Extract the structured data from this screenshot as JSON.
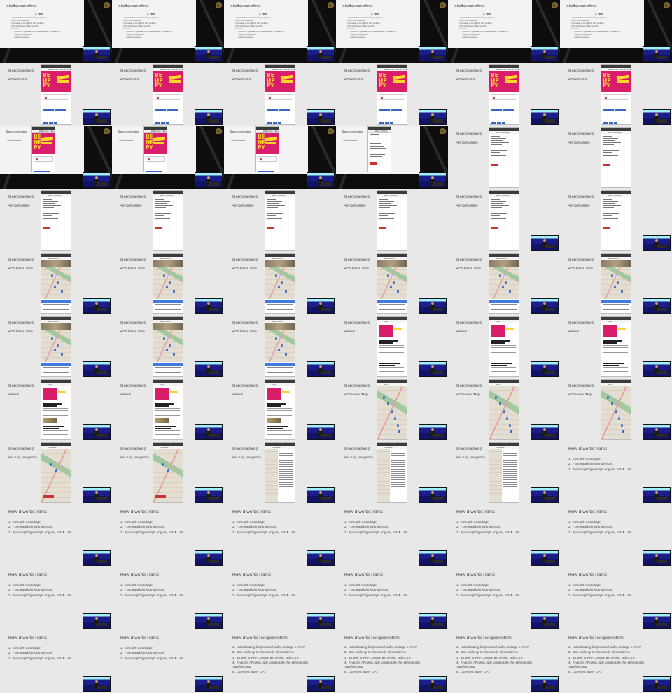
{
  "tiles": [
    {
      "type": "toc",
      "dark": true,
      "title": "Inhaltsverzeichnis"
    },
    {
      "type": "toc",
      "dark": true,
      "title": "Inhaltsverzeichnis"
    },
    {
      "type": "toc",
      "dark": true,
      "title": "Inhaltsverzeichnis"
    },
    {
      "type": "toc",
      "dark": true,
      "title": "Inhaltsverzeichnis"
    },
    {
      "type": "toc",
      "dark": true,
      "title": "Inhaltsverzeichnis"
    },
    {
      "type": "toc",
      "dark": true,
      "title": "Inhaltsverzeichnis"
    },
    {
      "type": "screen",
      "title": "Screenshots",
      "bullet": "• Dashboard",
      "phone": "dash"
    },
    {
      "type": "screen",
      "title": "Screenshots",
      "bullet": "• Dashboard",
      "phone": "dash"
    },
    {
      "type": "screen",
      "title": "Screenshots",
      "bullet": "• Dashboard",
      "phone": "dash"
    },
    {
      "type": "screen",
      "title": "Screenshots",
      "bullet": "• Dashboard",
      "phone": "dash"
    },
    {
      "type": "screen",
      "title": "Screenshots",
      "bullet": "• Dashboard",
      "phone": "dash"
    },
    {
      "type": "screen",
      "title": "Screenshots",
      "bullet": "• Dashboard",
      "phone": "dash"
    },
    {
      "type": "screen",
      "dark": true,
      "title": "Screenshots",
      "bullet": "• Dashboard",
      "phone": "dash"
    },
    {
      "type": "screen",
      "dark": true,
      "title": "Screenshots",
      "bullet": "• Dashboard",
      "phone": "dash"
    },
    {
      "type": "screen",
      "dark": true,
      "title": "Screenshots",
      "bullet": "• Dashboard",
      "phone": "dash"
    },
    {
      "type": "screen",
      "dark": true,
      "title": "Screenshots",
      "bullet": "• Dashboard",
      "phone": "engel"
    },
    {
      "type": "screen",
      "title": "Screenshots",
      "bullet": "• Engelsystem",
      "phone": "engel",
      "cam": false
    },
    {
      "type": "screen",
      "title": "Screenshots",
      "bullet": "• Engelsystem",
      "phone": "engel",
      "cam": false
    },
    {
      "type": "screen",
      "title": "Screenshots",
      "bullet": "• Engelsystem",
      "phone": "engel",
      "cam": false
    },
    {
      "type": "screen",
      "title": "Screenshots",
      "bullet": "• Engelsystem",
      "phone": "engel",
      "cam": false
    },
    {
      "type": "screen",
      "title": "Screenshots",
      "bullet": "• Engelsystem",
      "phone": "engel",
      "cam": false
    },
    {
      "type": "screen",
      "title": "Screenshots",
      "bullet": "• Engelsystem",
      "phone": "engel",
      "cam": false
    },
    {
      "type": "screen",
      "title": "Screenshots",
      "bullet": "• Engelsystem",
      "phone": "engel"
    },
    {
      "type": "screen",
      "title": "Screenshots",
      "bullet": "• Engelsystem",
      "phone": "engel"
    },
    {
      "type": "screen",
      "title": "Screenshots",
      "bullet": "• Ort Detail View",
      "phone": "mapdetail"
    },
    {
      "type": "screen",
      "title": "Screenshots",
      "bullet": "• Ort Detail View",
      "phone": "mapdetail"
    },
    {
      "type": "screen",
      "title": "Screenshots",
      "bullet": "• Ort Detail View",
      "phone": "mapdetail"
    },
    {
      "type": "screen",
      "title": "Screenshots",
      "bullet": "• Ort Detail View",
      "phone": "mapdetail"
    },
    {
      "type": "screen",
      "title": "Screenshots",
      "bullet": "• Ort Detail View",
      "phone": "mapdetail"
    },
    {
      "type": "screen",
      "title": "Screenshots",
      "bullet": "• Ort Detail View",
      "phone": "mapdetail"
    },
    {
      "type": "screen",
      "title": "Screenshots",
      "bullet": "• Ort Detail View",
      "phone": "mapdetail"
    },
    {
      "type": "screen",
      "title": "Screenshots",
      "bullet": "• Ort Detail View",
      "phone": "mapdetail"
    },
    {
      "type": "screen",
      "title": "Screenshots",
      "bullet": "• Ort Detail View",
      "phone": "mapdetail"
    },
    {
      "type": "screen",
      "title": "Screenshots",
      "bullet": "• News",
      "phone": "news"
    },
    {
      "type": "screen",
      "title": "Screenshots",
      "bullet": "• News",
      "phone": "news"
    },
    {
      "type": "screen",
      "title": "Screenshots",
      "bullet": "• News",
      "phone": "news"
    },
    {
      "type": "screen",
      "title": "Screenshots",
      "bullet": "• News",
      "phone": "news2"
    },
    {
      "type": "screen",
      "title": "Screenshots",
      "bullet": "• News",
      "phone": "news2"
    },
    {
      "type": "screen",
      "title": "Screenshots",
      "bullet": "• News",
      "phone": "news2"
    },
    {
      "type": "screen",
      "title": "Screenshots",
      "bullet": "• Overview Map",
      "phone": "overview"
    },
    {
      "type": "screen",
      "title": "Screenshots",
      "bullet": "• Overview Map",
      "phone": "overview"
    },
    {
      "type": "screen",
      "title": "Screenshots",
      "bullet": "• Overview Map",
      "phone": "overview"
    },
    {
      "type": "screen",
      "title": "Screenshots",
      "bullet": "• In-App Navigation",
      "phone": "navmap"
    },
    {
      "type": "screen",
      "title": "Screenshots",
      "bullet": "• In-App Navigation",
      "phone": "navmap"
    },
    {
      "type": "screen",
      "title": "Screenshots",
      "bullet": "• In-App Navigation",
      "phone": "navlist"
    },
    {
      "type": "screen",
      "title": "Screenshots",
      "bullet": "• In-App Navigation",
      "phone": "navlist"
    },
    {
      "type": "screen",
      "title": "Screenshots",
      "bullet": "• In-App Navigation",
      "phone": "navlist"
    },
    {
      "type": "ionic",
      "title": "How it works: Ionic"
    },
    {
      "type": "ionic",
      "title": "How it works: Ionic"
    },
    {
      "type": "ionic",
      "title": "How it works: Ionic"
    },
    {
      "type": "ionic",
      "title": "How it works: Ionic"
    },
    {
      "type": "ionic",
      "title": "How it works: Ionic"
    },
    {
      "type": "ionic",
      "title": "How it works: Ionic"
    },
    {
      "type": "ionic",
      "title": "How it works: Ionic"
    },
    {
      "type": "ionic",
      "title": "How it works: Ionic"
    },
    {
      "type": "ionic",
      "title": "How it works: Ionic"
    },
    {
      "type": "ionic",
      "title": "How it works: Ionic"
    },
    {
      "type": "ionic",
      "title": "How it works: Ionic"
    },
    {
      "type": "ionic",
      "title": "How it works: Ionic"
    },
    {
      "type": "ionic",
      "title": "How it works: Ionic"
    },
    {
      "type": "ionic",
      "title": "How it works: Ionic"
    },
    {
      "type": "ionic",
      "title": "How it works: Ionic"
    },
    {
      "type": "engel",
      "title": "How it works: Engelsystem"
    },
    {
      "type": "engel",
      "title": "How it works: Engelsystem"
    },
    {
      "type": "engel",
      "title": "How it works: Engelsystem"
    },
    {
      "type": "engel",
      "title": "How it works: Engelsystem"
    }
  ],
  "toc": {
    "heading": "1. Fazit",
    "items": [
      "1.  August 2015 als universitäres Projekt gestartet",
      "2.  Initial: ASWS; Intensiver",
      "3.  Von Anfang an bei Capsfail: Tests veröffentl.",
      "4.  Weiterentwicklung (stabil App (2016)",
      "5.  Weiteres"
    ],
    "sub": [
      "Screenshot Tagesablauf von gezeigt Alternativ im Trailkleuy zu",
      "Screenshot/Fotos Raum",
      "Von für Engelsystem"
    ]
  },
  "ionic_items": [
    "Ionic als Grundlage",
    "Framework für hybride Apps",
    "Javascript/Typescript, Angular, HTML, etc."
  ],
  "engel_items": [
    "„coordinating helpers and shifts on large events“",
    "Can scale up to thousands of volunteers",
    "Written in PHP, Javascript, HTML, and CSS",
    "An extra API was built to integrate this service into Turnfest-App",
    "Licensed under GPL"
  ],
  "phone_titles": {
    "dash": "Willkommen, Johannes Maus",
    "engel": "Meine Schichten",
    "mapdetail": "Maus-Diskos",
    "news": "News",
    "overview": "Karte",
    "navlist": "Navigation"
  },
  "poster_letters": "BE\nHP\nPY"
}
